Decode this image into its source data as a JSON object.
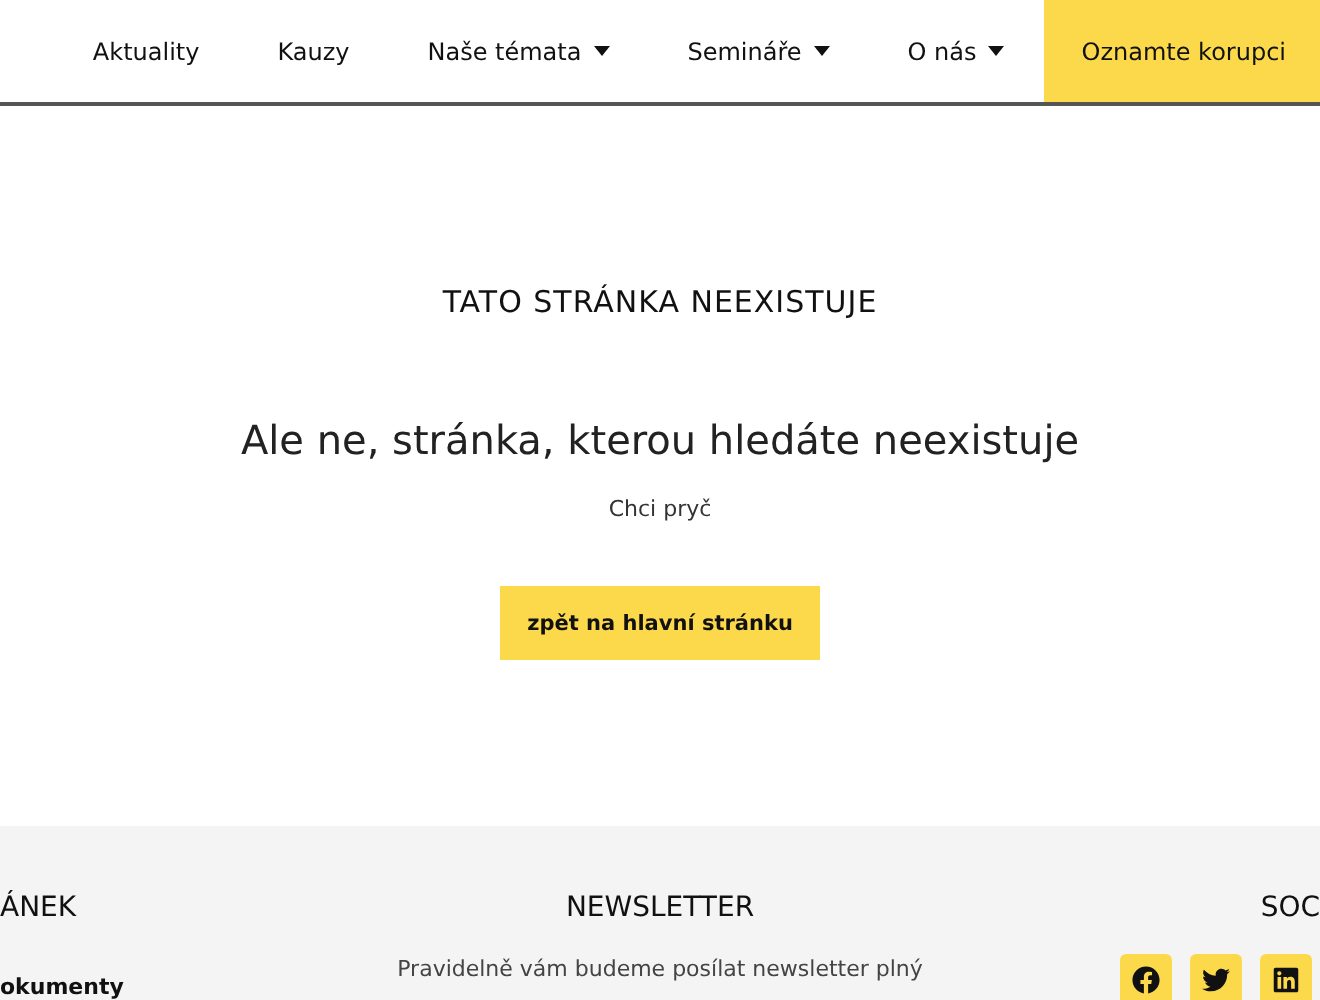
{
  "nav": {
    "items": [
      {
        "label": "Aktuality",
        "dropdown": false
      },
      {
        "label": "Kauzy",
        "dropdown": false
      },
      {
        "label": "Naše témata",
        "dropdown": true
      },
      {
        "label": "Semináře",
        "dropdown": true
      },
      {
        "label": "O nás",
        "dropdown": true
      }
    ],
    "cta": "Oznamte korupci"
  },
  "error": {
    "heading": "TATO STRÁNKA NEEXISTUJE",
    "title": "Ale ne, stránka, kterou hledáte neexistuje",
    "subtitle": "Chci pryč",
    "button": "zpět na hlavní stránku"
  },
  "footer": {
    "left": {
      "heading": "ÁNEK",
      "link": "okumenty"
    },
    "newsletter": {
      "heading": "NEWSLETTER",
      "text": "Pravidelně vám budeme posílat newsletter plný"
    },
    "social": {
      "heading": "SOC",
      "icons": [
        {
          "kind": "facebook"
        },
        {
          "kind": "twitter"
        },
        {
          "kind": "linkedin"
        }
      ]
    }
  }
}
